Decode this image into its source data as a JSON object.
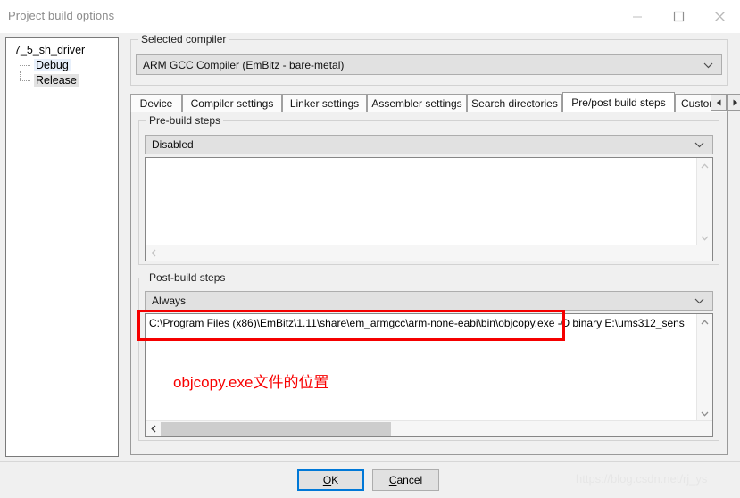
{
  "window": {
    "title": "Project build options",
    "controls": [
      {
        "name": "minimize",
        "glyph": "minimize-icon"
      },
      {
        "name": "maximize",
        "glyph": "maximize-icon"
      },
      {
        "name": "close",
        "glyph": "close-icon"
      }
    ]
  },
  "tree": {
    "root": "7_5_sh_driver",
    "children": [
      {
        "label": "Debug",
        "state": "highlighted"
      },
      {
        "label": "Release",
        "state": "selected"
      }
    ]
  },
  "compiler_group": {
    "legend": "Selected compiler",
    "selected": "ARM GCC Compiler (EmBitz - bare-metal)"
  },
  "tabs": {
    "items": [
      {
        "label": "Device",
        "active": false
      },
      {
        "label": "Compiler settings",
        "active": false
      },
      {
        "label": "Linker settings",
        "active": false
      },
      {
        "label": "Assembler settings",
        "active": false
      },
      {
        "label": "Search directories",
        "active": false
      },
      {
        "label": "Pre/post build steps",
        "active": true
      },
      {
        "label": "Custom v",
        "active": false
      }
    ],
    "scroll_left": "◄",
    "scroll_right": "►"
  },
  "prebuild": {
    "legend": "Pre-build steps",
    "mode": "Disabled",
    "commands": ""
  },
  "postbuild": {
    "legend": "Post-build steps",
    "mode": "Always",
    "commands": "C:\\Program Files (x86)\\EmBitz\\1.11\\share\\em_armgcc\\arm-none-eabi\\bin\\objcopy.exe -O binary E:\\ums312_sens"
  },
  "annotation": {
    "text": "objcopy.exe文件的位置",
    "color": "#f80000"
  },
  "footer": {
    "ok_pre": "O",
    "ok_post": "K",
    "cancel_pre": "C",
    "cancel_post": "ancel",
    "ok_label": "OK",
    "cancel_label": "Cancel"
  },
  "watermark": "https://blog.csdn.net/rj_ys",
  "colors": {
    "accent": "#0078d7",
    "annotation": "#f80000",
    "dialog_bg": "#f0f0f0",
    "control_bg": "#e1e1e1"
  }
}
